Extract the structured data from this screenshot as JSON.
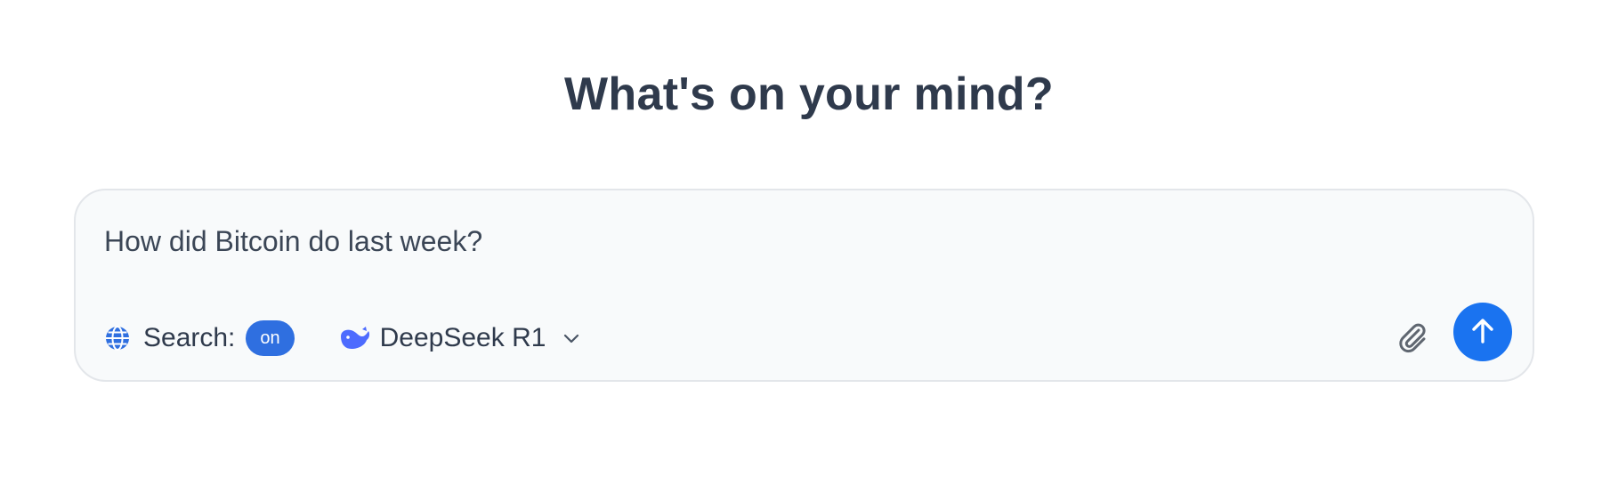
{
  "heading": "What's on your mind?",
  "composer": {
    "input_value": "How did Bitcoin do last week?",
    "search": {
      "icon": "globe-icon",
      "label": "Search:",
      "state": "on"
    },
    "model": {
      "icon": "whale-icon",
      "label": "DeepSeek R1",
      "dropdown_icon": "chevron-down-icon"
    },
    "attach_icon": "paperclip-icon",
    "send_icon": "arrow-up-icon"
  },
  "colors": {
    "accent": "#1a73f0",
    "pill": "#2f6fe0",
    "whale": "#4d6bfe",
    "heading": "#2f3a4c",
    "composer_bg": "#f8fafb",
    "composer_border": "#e3e6ea"
  }
}
